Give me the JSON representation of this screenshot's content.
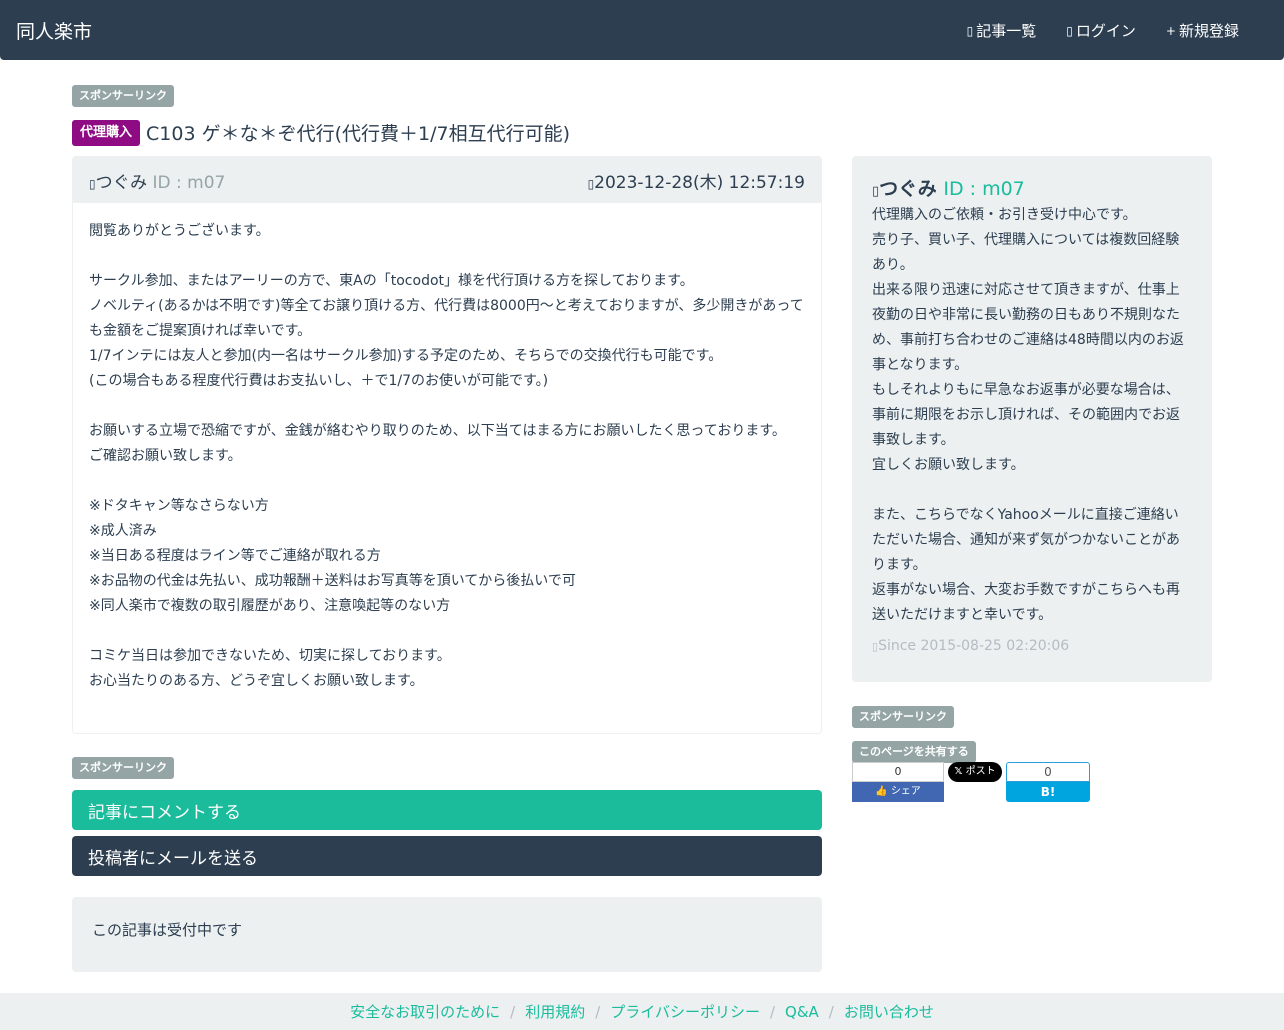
{
  "nav": {
    "brand": "同人楽市",
    "links": [
      {
        "icon": "file-icon",
        "glyph": "▯",
        "label": "記事一覧"
      },
      {
        "icon": "login-icon",
        "glyph": "▯",
        "label": "ログイン"
      },
      {
        "icon": "plus-icon",
        "glyph": "+",
        "label": "新規登録"
      }
    ]
  },
  "sponsor_label": "スポンサーリンク",
  "article": {
    "category": "代理購入",
    "title": "C103 ゲ＊な＊ぞ代行(代行費＋1/7相互代行可能)",
    "author_name": "つぐみ",
    "author_id": "ID : m07",
    "datetime": "2023-12-28(木) 12:57:19",
    "body": [
      "閲覧ありがとうございます。",
      "",
      "サークル参加、またはアーリーの方で、東Aの「tocodot」様を代行頂ける方を探しております。",
      "ノベルティ(あるかは不明です)等全てお譲り頂ける方、代行費は8000円〜と考えておりますが、多少開きがあっても金額をご提案頂ければ幸いです。",
      "1/7インテには友人と参加(内一名はサークル参加)する予定のため、そちらでの交換代行も可能です。",
      "(この場合もある程度代行費はお支払いし、＋で1/7のお使いが可能です。)",
      "",
      "お願いする立場で恐縮ですが、金銭が絡むやり取りのため、以下当てはまる方にお願いしたく思っております。",
      "ご確認お願い致します。",
      "",
      "※ドタキャン等なさらない方",
      "※成人済み",
      "※当日ある程度はライン等でご連絡が取れる方",
      "※お品物の代金は先払い、成功報酬＋送料はお写真等を頂いてから後払いで可",
      "※同人楽市で複数の取引履歴があり、注意喚起等のない方",
      "",
      "コミケ当日は参加できないため、切実に探しております。",
      "お心当たりのある方、どうぞ宜しくお願い致します。"
    ]
  },
  "actions": {
    "comment": "記事にコメントする",
    "mail": "投稿者にメールを送る"
  },
  "status": "この記事は受付中です",
  "profile": {
    "name": "つぐみ",
    "id": "ID : m07",
    "bio": [
      "代理購入のご依頼・お引き受け中心です。",
      "売り子、買い子、代理購入については複数回経験あり。",
      "出来る限り迅速に対応させて頂きますが、仕事上夜勤の日や非常に長い勤務の日もあり不規則なため、事前打ち合わせのご連絡は48時間以内のお返事となります。",
      "もしそれよりもに早急なお返事が必要な場合は、事前に期限をお示し頂ければ、その範囲内でお返事致します。",
      "宜しくお願い致します。",
      "",
      "また、こちらでなくYahooメールに直接ご連絡いただいた場合、通知が来ず気がつかないことがあります。",
      "返事がない場合、大変お手数ですがこちらへも再送いただけますと幸いです。"
    ],
    "since": "Since 2015-08-25 02:20:06"
  },
  "share": {
    "label": "このページを共有する",
    "fb_count": "0",
    "fb_button": "シェア",
    "tw_button": "ポスト",
    "hb_count": "0",
    "hb_button": "B! Bookmark"
  },
  "footer": [
    "安全なお取引のために",
    "利用規約",
    "プライバシーポリシー",
    "Q&A",
    "お問い合わせ"
  ],
  "colors": {
    "navbar": "#2c3e50",
    "accent": "#1abc9c",
    "category": "#8e0b83"
  }
}
